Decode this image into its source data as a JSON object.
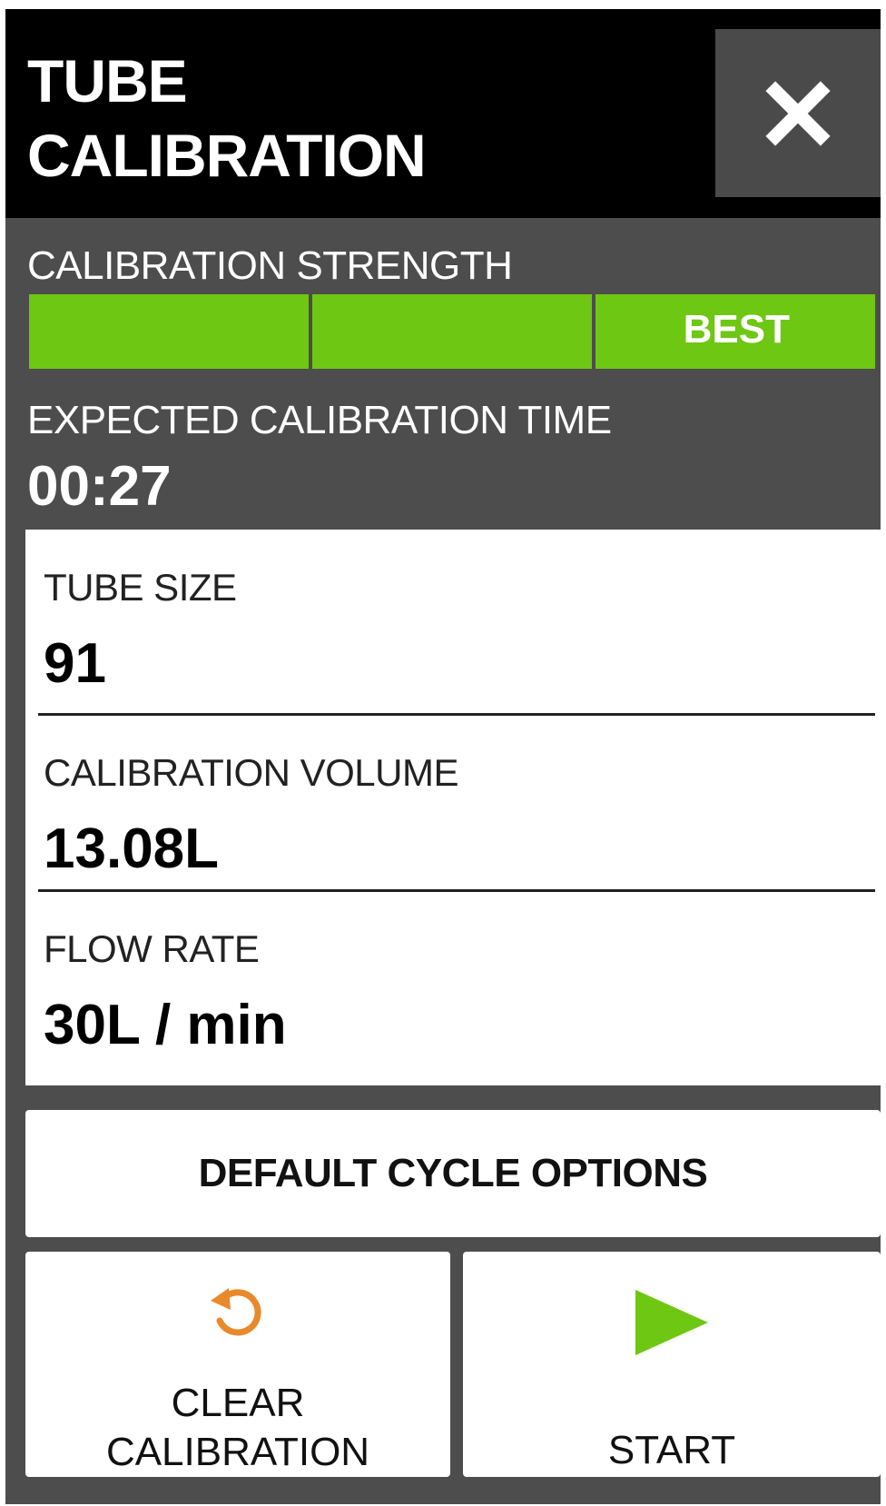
{
  "header": {
    "title_line1": "TUBE",
    "title_line2": "CALIBRATION",
    "close_icon": "close-icon"
  },
  "calibration_strength": {
    "label": "CALIBRATION STRENGTH",
    "segments_filled": 3,
    "segments_total": 3,
    "level_label": "BEST",
    "color": "#6ec712"
  },
  "expected_time": {
    "label": "EXPECTED CALIBRATION TIME",
    "value": "00:27"
  },
  "settings": [
    {
      "label": "TUBE SIZE",
      "value": "91"
    },
    {
      "label": "CALIBRATION VOLUME",
      "value": "13.08L"
    },
    {
      "label": "FLOW RATE",
      "value": "30L / min"
    }
  ],
  "buttons": {
    "default_cycle_options": "DEFAULT CYCLE OPTIONS",
    "clear_calibration_line1": "CLEAR",
    "clear_calibration_line2": "CALIBRATION",
    "clear_icon": "refresh-icon",
    "clear_icon_color": "#e8892a",
    "start": "START",
    "start_icon": "play-icon",
    "start_icon_color": "#6ec712"
  },
  "colors": {
    "header_bg": "#000000",
    "panel_bg": "#4d4d4d",
    "close_btn_bg": "#4a4a4a"
  }
}
